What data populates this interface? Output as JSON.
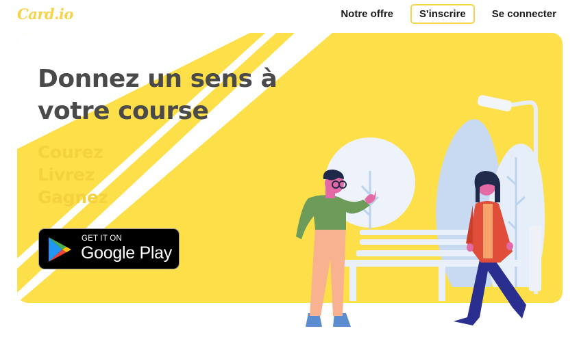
{
  "header": {
    "logo": "Card.io",
    "nav": {
      "offer_label": "Notre offre",
      "signup_label": "S'inscrire",
      "login_label": "Se connecter"
    }
  },
  "hero": {
    "headline_line1": "Donnez un sens à",
    "headline_line2": "votre course",
    "verbs": [
      "Courez",
      "Livrez",
      "Gagnez"
    ],
    "store_badge": {
      "small_text": "GET IT ON",
      "big_text": "Google Play"
    }
  },
  "colors": {
    "brand_yellow": "#fddf4a",
    "accent_yellow": "#f4d13f",
    "headline_gray": "#4a4a4a"
  },
  "icons": [
    "google-play-icon",
    "park-illustration"
  ]
}
